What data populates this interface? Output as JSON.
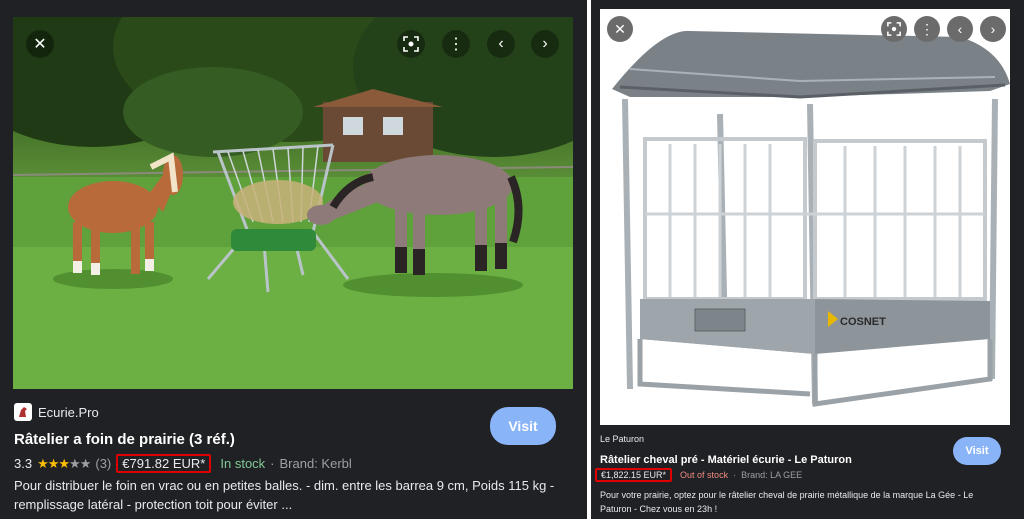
{
  "left": {
    "source_name": "Ecurie.Pro",
    "title": "Râtelier a foin de prairie (3 réf.)",
    "rating_value": "3.3",
    "rating_count": "(3)",
    "price": "€791.82 EUR*",
    "stock": "In stock",
    "separator": "·",
    "brand": "Brand: Kerbl",
    "description_line1": "Pour distribuer le foin en vrac ou en petites balles. - dim. entre les barrea 9 cm, Poids 115 kg -",
    "description_line2": "remplissage latéral - protection toit pour éviter ...",
    "visit_label": "Visit",
    "icons": {
      "close": "close-icon",
      "lens": "lens-icon",
      "more": "more-vert-icon",
      "prev": "chevron-left-icon",
      "next": "chevron-right-icon"
    }
  },
  "right": {
    "source_name": "Le Paturon",
    "title": "Râtelier cheval pré - Matériel écurie - Le Paturon",
    "price": "€1,822.15 EUR*",
    "stock": "Out of stock",
    "separator": "·",
    "brand": "Brand: LA GEE",
    "description_line1": "Pour votre prairie, optez pour le râtelier cheval de prairie métallique de la marque La Gée - Le",
    "description_line2": "Paturon - Chez vous en 23h !",
    "visit_label": "Visit",
    "product_logo": "COSNET"
  },
  "colors": {
    "accent": "#8ab4f8",
    "in_stock": "#81c995",
    "out_of_stock": "#f28b82",
    "highlight": "#e00000"
  }
}
